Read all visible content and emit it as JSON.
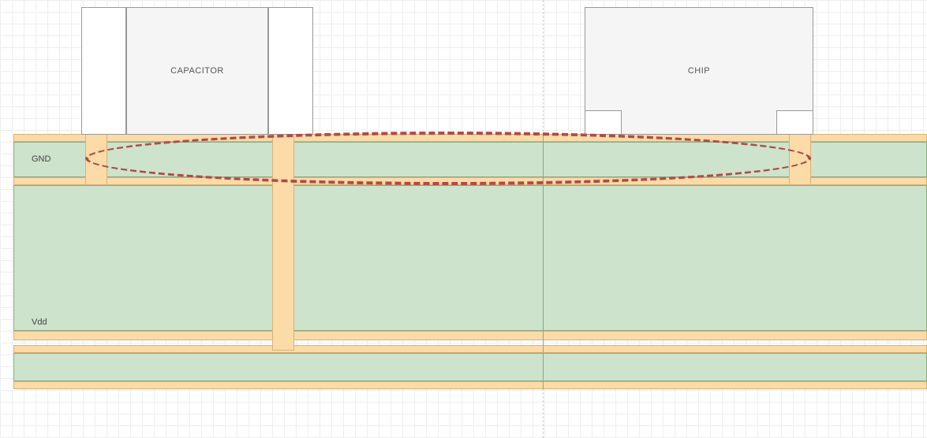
{
  "components": {
    "capacitor": {
      "label": "CAPACITOR"
    },
    "chip": {
      "label": "CHIP"
    }
  },
  "layers": {
    "gnd": {
      "label": "GND"
    },
    "vdd": {
      "label": "Vdd"
    }
  },
  "annotation": {
    "current_loop": "current-loop-ellipse"
  },
  "colors": {
    "copper_plane": "#cde3cb",
    "copper_trace": "#fbdba8",
    "annotation": "#b04a4a"
  }
}
